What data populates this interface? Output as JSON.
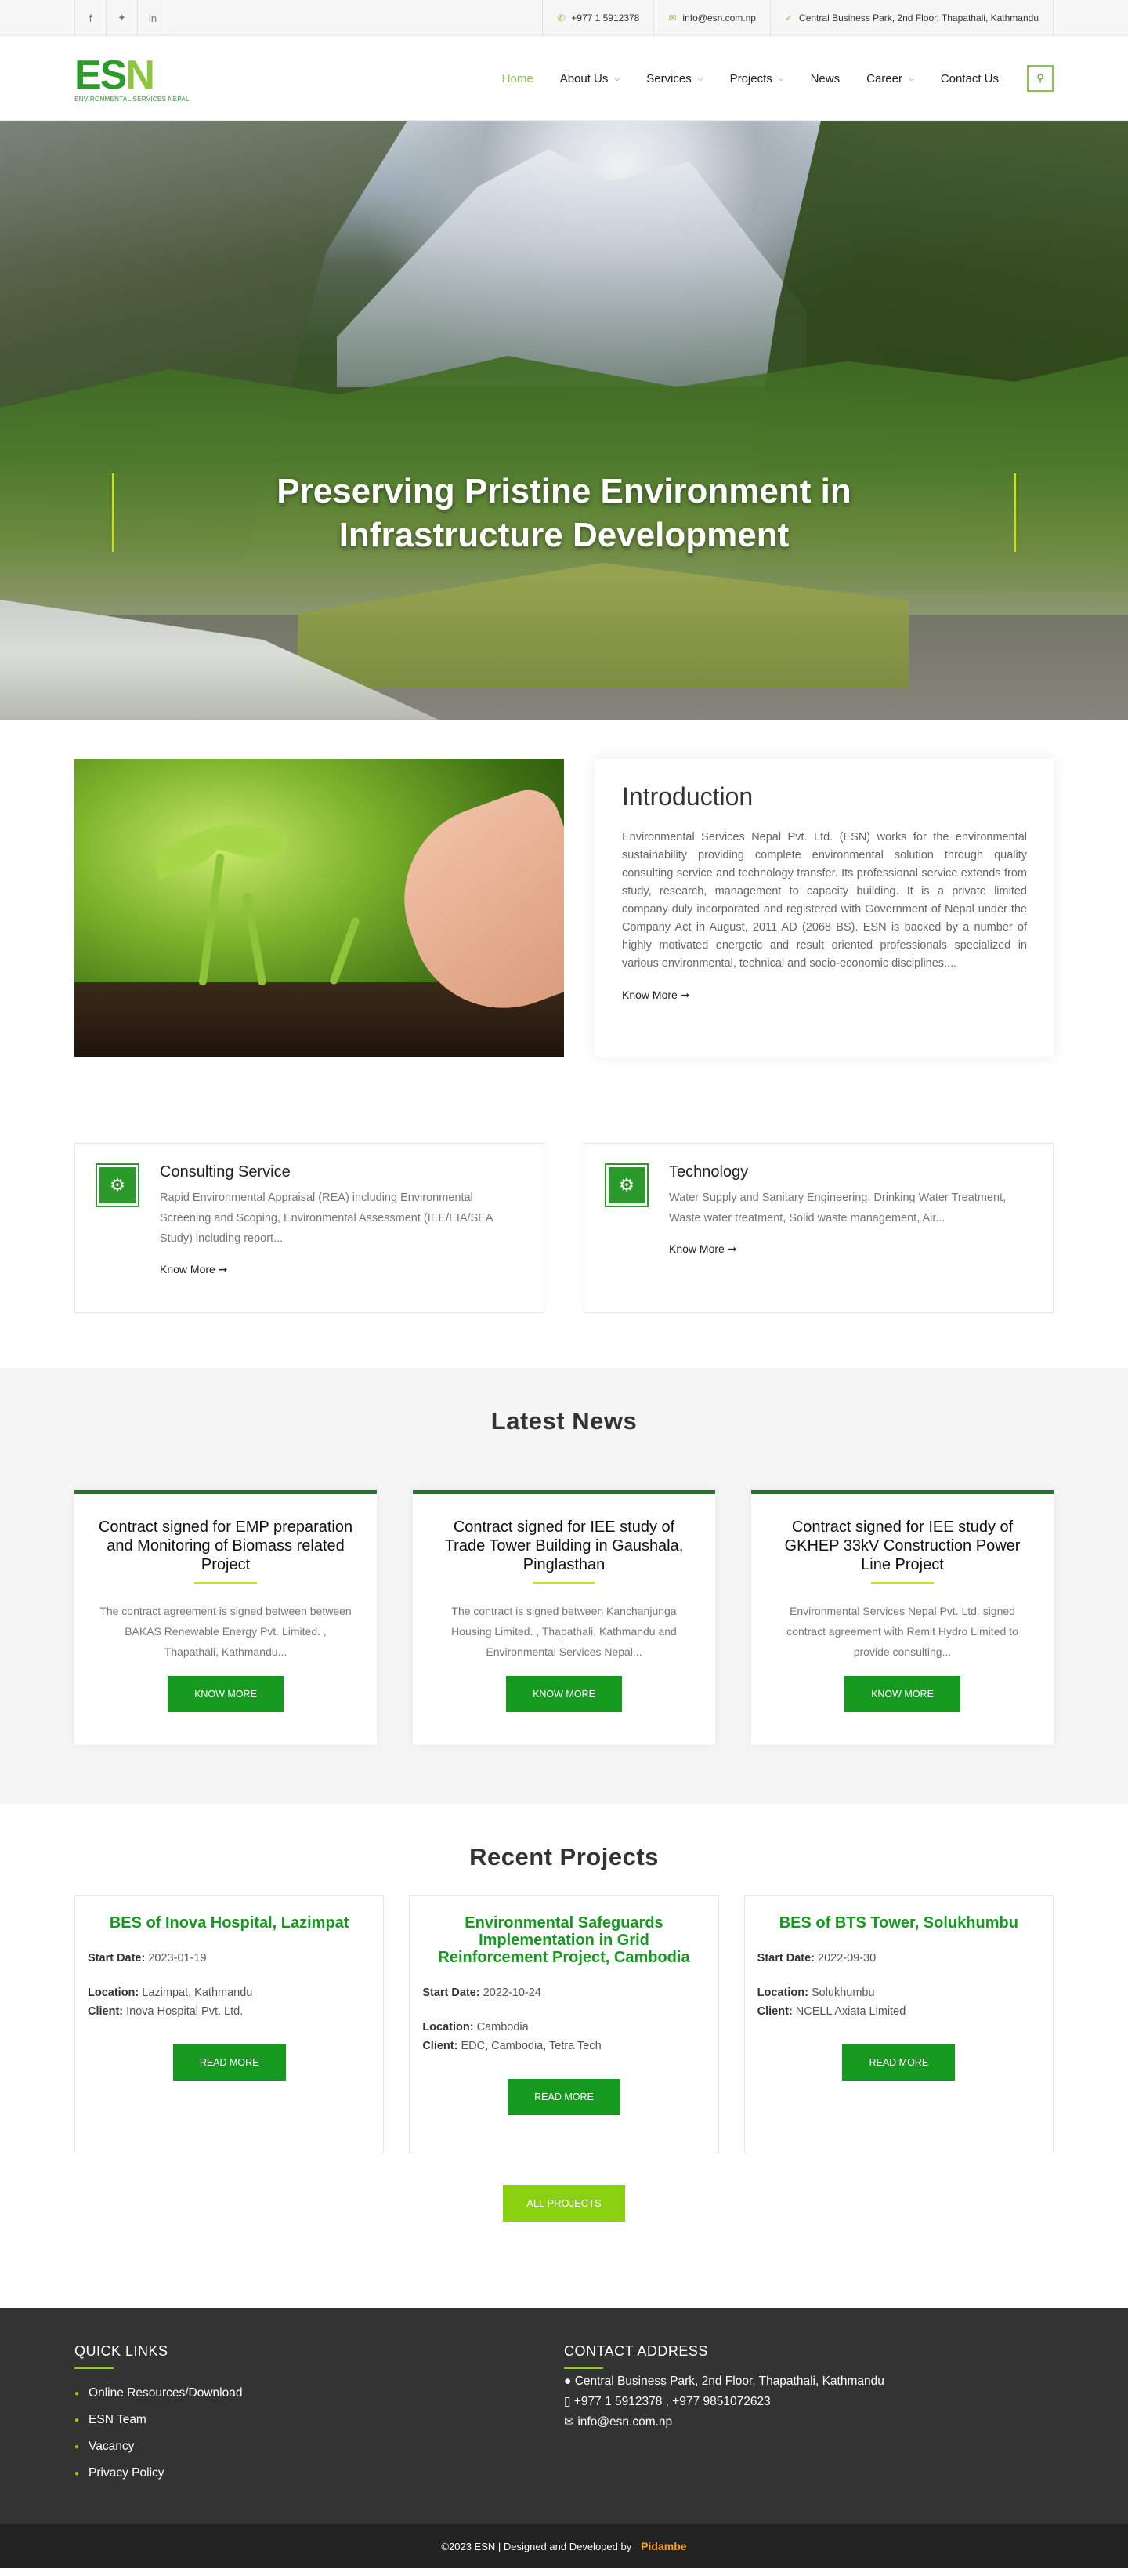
{
  "topbar": {
    "social": [
      {
        "icon": "facebook-icon",
        "glyph": "f"
      },
      {
        "icon": "twitter-icon",
        "glyph": "🐦"
      },
      {
        "icon": "linkedin-icon",
        "glyph": "in"
      }
    ],
    "phone": "+977 1 5912378",
    "email": "info@esn.com.np",
    "address": "Central Business Park, 2nd Floor, Thapathali, Kathmandu"
  },
  "header": {
    "logo_text": "ESN",
    "logo_sub": "ENVIRONMENTAL SERVICES NEPAL",
    "nav": [
      {
        "label": "Home",
        "dropdown": false,
        "active": true
      },
      {
        "label": "About Us",
        "dropdown": true
      },
      {
        "label": "Services",
        "dropdown": true
      },
      {
        "label": "Projects",
        "dropdown": true
      },
      {
        "label": "News",
        "dropdown": false
      },
      {
        "label": "Career",
        "dropdown": true
      },
      {
        "label": "Contact Us",
        "dropdown": false
      }
    ]
  },
  "hero": {
    "line1": "Preserving Pristine Environment in",
    "line2": "Infrastructure Development"
  },
  "intro": {
    "title": "Introduction",
    "body": "Environmental Services Nepal Pvt. Ltd. (ESN) works for the environmental sustainability providing complete environmental solution through quality consulting service and technology transfer. Its professional service extends from study, research, management to capacity building. It is a private limited company duly incorporated and registered with Government of Nepal under the Company Act in August, 2011 AD (2068 BS). ESN is backed by a number of highly motivated energetic and result oriented professionals specialized in various environmental, technical and socio-economic disciplines....",
    "link": "Know More ➞"
  },
  "services": [
    {
      "title": "Consulting Service",
      "text": "Rapid Environmental Appraisal (REA) including Environmental Screening and Scoping, Environmental Assessment (IEE/EIA/SEA Study) including report...",
      "link": "Know More ➞"
    },
    {
      "title": "Technology",
      "text": "Water Supply and Sanitary Engineering, Drinking Water Treatment, Waste water treatment, Solid waste management, Air...",
      "link": "Know More ➞"
    }
  ],
  "news": {
    "title": "Latest News",
    "items": [
      {
        "title": "Contract signed for EMP preparation and Monitoring of Biomass related Project",
        "text": "The contract agreement is signed between between BAKAS Renewable Energy Pvt. Limited. , Thapathali, Kathmandu...",
        "button": "KNOW MORE"
      },
      {
        "title": "Contract signed for IEE study of Trade Tower Building in Gaushala, Pinglasthan",
        "text": "The contract is signed between Kanchanjunga Housing Limited. , Thapathali, Kathmandu and Environmental Services Nepal...",
        "button": "KNOW MORE"
      },
      {
        "title": "Contract signed for IEE study of GKHEP 33kV Construction Power Line Project",
        "text": "Environmental Services Nepal Pvt. Ltd. signed contract agreement with Remit Hydro Limited to provide consulting...",
        "button": "KNOW MORE"
      }
    ]
  },
  "projects": {
    "title": "Recent Projects",
    "labels": {
      "start": "Start Date:",
      "location": "Location:",
      "client": "Client:"
    },
    "items": [
      {
        "title": "BES of Inova Hospital, Lazimpat",
        "start": "2023-01-19",
        "location": "Lazimpat, Kathmandu",
        "client": "Inova Hospital Pvt. Ltd.",
        "button": "READ MORE"
      },
      {
        "title": "Environmental Safeguards Implementation in Grid Reinforcement Project, Cambodia",
        "start": "2022-10-24",
        "location": "Cambodia",
        "client": "EDC, Cambodia, Tetra Tech",
        "button": "READ MORE"
      },
      {
        "title": "BES of BTS Tower, Solukhumbu",
        "start": "2022-09-30",
        "location": "Solukhumbu",
        "client": "NCELL Axiata Limited",
        "button": "READ MORE"
      }
    ],
    "all_button": "ALL PROJECTS"
  },
  "footer": {
    "quick_title": "QUICK LINKS",
    "links": [
      "Online Resources/Download",
      "ESN Team",
      "Vacancy",
      "Privacy Policy"
    ],
    "contact_title": "CONTACT ADDRESS",
    "address": "Central Business Park, 2nd Floor, Thapathali, Kathmandu",
    "phones": "+977 1 5912378 , +977 9851072623",
    "email": "info@esn.com.np",
    "copyright": "©2023 ESN | Designed and Developed by",
    "developer": "Pidambe"
  },
  "colors": {
    "brand_green": "#16991f",
    "accent_lime": "#8cd012",
    "nav_active": "#8bc34a"
  }
}
